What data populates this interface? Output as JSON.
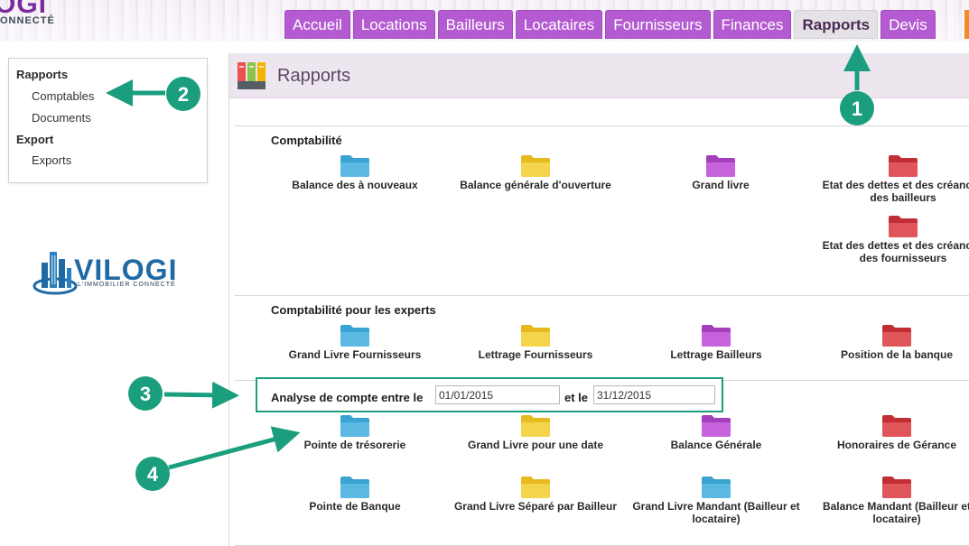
{
  "header": {
    "logo_text": "OGI",
    "logo_subtext": "ONNECTÉ",
    "tabs": [
      "Accueil",
      "Locations",
      "Bailleurs",
      "Locataires",
      "Fournisseurs",
      "Finances",
      "Rapports",
      "Devis"
    ],
    "active_tab": "Rapports"
  },
  "sidebar": {
    "groups": [
      {
        "heading": "Rapports",
        "items": [
          "Comptables",
          "Documents"
        ]
      },
      {
        "heading": "Export",
        "items": [
          "Exports"
        ]
      }
    ]
  },
  "brand": {
    "name": "VILOGI",
    "tagline": "L'IMMOBILIER CONNECTÉ"
  },
  "main": {
    "title": "Rapports",
    "sections": [
      {
        "title": "Comptabilité",
        "reports": [
          {
            "label": "Balance des à nouveaux",
            "color": "#3aa3d2"
          },
          {
            "label": "Balance générale d'ouverture",
            "color": "#f0c832"
          },
          {
            "label": "Grand livre",
            "color": "#b94fd0"
          },
          {
            "label": "Etat des dettes et des créances des bailleurs",
            "color": "#d43a40"
          },
          {
            "label": "Etat des dettes et des créances des fournisseurs",
            "color": "#d43a40"
          }
        ]
      },
      {
        "title": "Comptabilité pour les experts",
        "reports": [
          {
            "label": "Grand Livre Fournisseurs",
            "color": "#3aa3d2"
          },
          {
            "label": "Lettrage Fournisseurs",
            "color": "#f0c832"
          },
          {
            "label": "Lettrage Bailleurs",
            "color": "#b94fd0"
          },
          {
            "label": "Position de la banque",
            "color": "#d43a40"
          }
        ]
      },
      {
        "analysis": {
          "label_start": "Analyse de compte entre le",
          "start_date": "01/01/2015",
          "label_and": "et le",
          "end_date": "31/12/2015"
        },
        "reports": [
          {
            "label": "Pointe de trésorerie",
            "color": "#3aa3d2"
          },
          {
            "label": "Grand Livre pour une date",
            "color": "#f0c832"
          },
          {
            "label": "Balance Générale",
            "color": "#b94fd0"
          },
          {
            "label": "Honoraires de Gérance",
            "color": "#d43a40"
          },
          {
            "label": "Pointe de Banque",
            "color": "#3aa3d2"
          },
          {
            "label": "Grand Livre Séparé par Bailleur",
            "color": "#f0c832"
          },
          {
            "label": "Grand Livre Mandant (Bailleur et locataire)",
            "color": "#3aa3d2"
          },
          {
            "label": "Balance Mandant (Bailleur et locataire)",
            "color": "#d43a40"
          }
        ]
      }
    ]
  },
  "annotations": {
    "color": "#1a9e7e",
    "badges": [
      "1",
      "2",
      "3",
      "4"
    ]
  }
}
